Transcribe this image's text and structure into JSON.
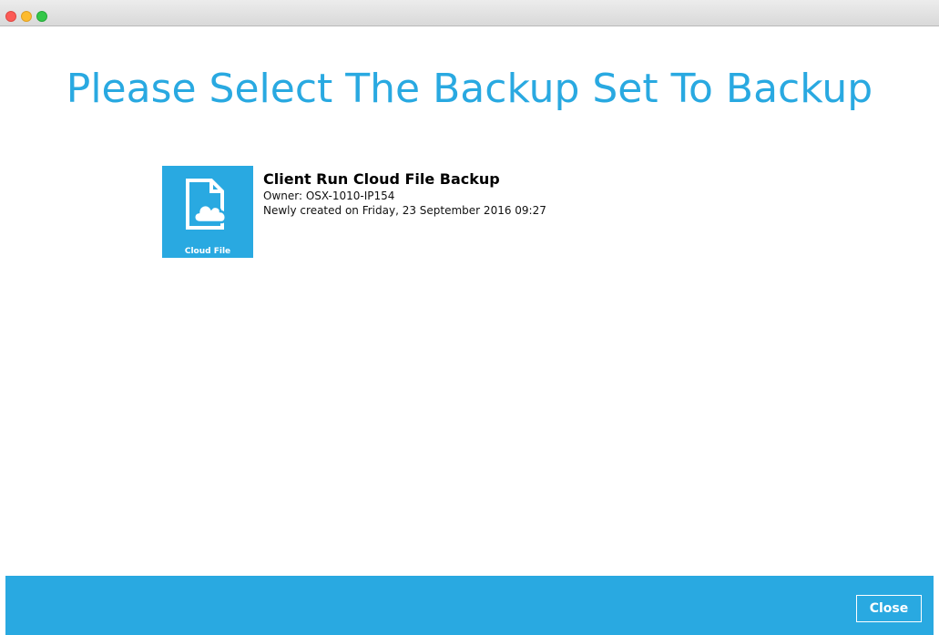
{
  "window": {
    "controls": [
      "close",
      "minimize",
      "zoom"
    ]
  },
  "heading": "Please Select The Backup Set To Backup",
  "backup_sets": [
    {
      "icon": "cloud-file-icon",
      "icon_label": "Cloud File",
      "name": "Client Run Cloud File Backup",
      "owner": "Owner: OSX-1010-IP154",
      "created": "Newly created on Friday, 23 September 2016 09:27"
    }
  ],
  "footer": {
    "close_label": "Close"
  },
  "colors": {
    "accent": "#29a9e1",
    "background": "#ffffff",
    "footer_text": "#ffffff"
  }
}
